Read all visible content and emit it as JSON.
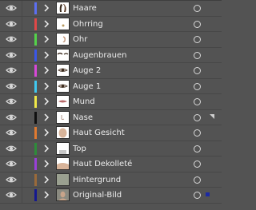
{
  "layers": [
    {
      "name": "Haare",
      "color": "#5c6ff2",
      "thumb": "hair-icon"
    },
    {
      "name": "Ohrring",
      "color": "#e04848",
      "thumb": "earring-icon"
    },
    {
      "name": "Ohr",
      "color": "#54d24a",
      "thumb": "ear-icon"
    },
    {
      "name": "Augenbrauen",
      "color": "#3a56e8",
      "thumb": "eyebrows-icon"
    },
    {
      "name": "Auge 2",
      "color": "#d848d8",
      "thumb": "eye-icon"
    },
    {
      "name": "Auge 1",
      "color": "#40c8f0",
      "thumb": "eye-icon"
    },
    {
      "name": "Mund",
      "color": "#f0e848",
      "thumb": "mouth-icon"
    },
    {
      "name": "Nase",
      "color": "#101010",
      "thumb": "nose-icon"
    },
    {
      "name": "Haut Gesicht",
      "color": "#e07a30",
      "thumb": "face-skin-icon"
    },
    {
      "name": "Top",
      "color": "#2e8c3a",
      "thumb": "top-icon"
    },
    {
      "name": "Haut Dekolleté",
      "color": "#9a40d8",
      "thumb": "decollete-skin-icon"
    },
    {
      "name": "Hintergrund",
      "color": "#9a6a3a",
      "thumb": "background-icon"
    },
    {
      "name": "Original-Bild",
      "color": "#141890",
      "thumb": "photo-icon",
      "selected": true
    }
  ]
}
